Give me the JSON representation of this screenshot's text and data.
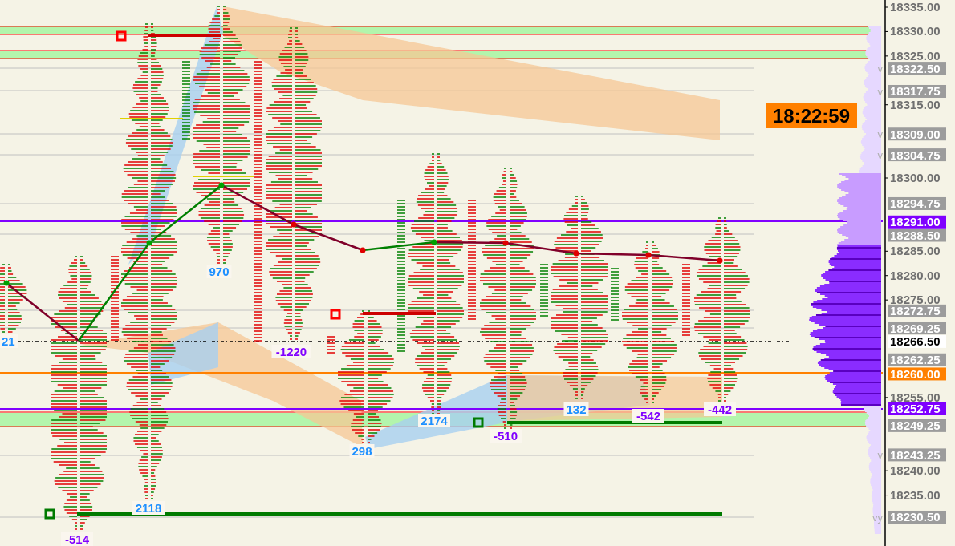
{
  "price_axis": {
    "ticks": [
      "18335.00",
      "18330.00",
      "18325.00",
      "18315.00",
      "18300.00",
      "18285.00",
      "18280.00",
      "18275.00",
      "18255.00",
      "18240.00",
      "18235.00"
    ],
    "labels": [
      {
        "text": "18322.50",
        "kind": "level",
        "tag": "v"
      },
      {
        "text": "18317.75",
        "kind": "level",
        "tag": "v"
      },
      {
        "text": "18309.00",
        "kind": "level",
        "tag": "v"
      },
      {
        "text": "18304.75",
        "kind": "level",
        "tag": "v"
      },
      {
        "text": "18294.75",
        "kind": "level"
      },
      {
        "text": "18291.00",
        "kind": "highlight"
      },
      {
        "text": "18288.50",
        "kind": "level"
      },
      {
        "text": "18272.75",
        "kind": "level"
      },
      {
        "text": "18269.25",
        "kind": "level"
      },
      {
        "text": "18266.50",
        "kind": "last"
      },
      {
        "text": "18262.25",
        "kind": "level"
      },
      {
        "text": "18260.00",
        "kind": "orange"
      },
      {
        "text": "18252.75",
        "kind": "highlight"
      },
      {
        "text": "18249.25",
        "kind": "level"
      },
      {
        "text": "18243.25",
        "kind": "level",
        "tag": "v"
      },
      {
        "text": "18230.50",
        "kind": "level",
        "tag": "vy"
      }
    ]
  },
  "clock": "18:22:59",
  "deltas": [
    {
      "value": "21",
      "kind": "positive"
    },
    {
      "value": "-514",
      "kind": "negative"
    },
    {
      "value": "2118",
      "kind": "positive"
    },
    {
      "value": "970",
      "kind": "positive"
    },
    {
      "value": "-1220",
      "kind": "negative"
    },
    {
      "value": "298",
      "kind": "positive"
    },
    {
      "value": "2174",
      "kind": "positive"
    },
    {
      "value": "-510",
      "kind": "negative"
    },
    {
      "value": "132",
      "kind": "positive"
    },
    {
      "value": "-542",
      "kind": "negative"
    },
    {
      "value": "-442",
      "kind": "negative"
    }
  ]
}
